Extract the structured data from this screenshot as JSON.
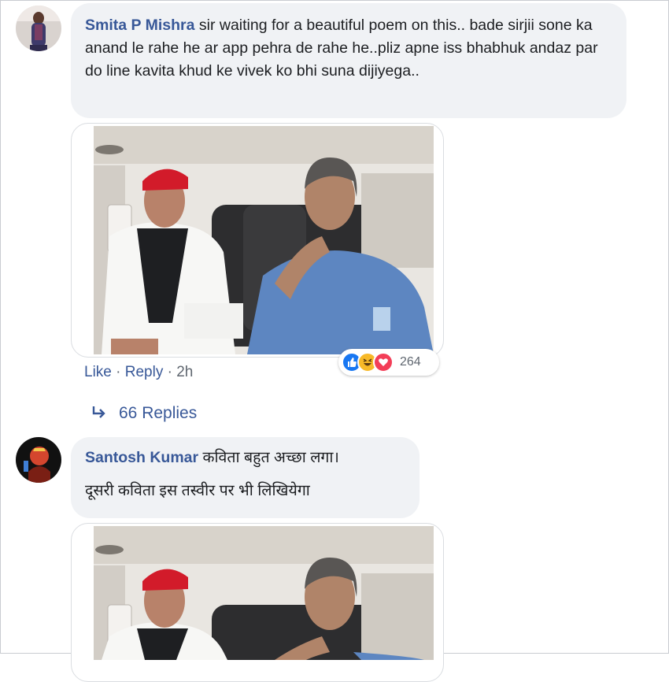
{
  "comments": [
    {
      "author": "Smita P Mishra",
      "text": " sir waiting for a beautiful poem on this.. bade sirjii sone ka anand le rahe he ar app pehra de rahe he..pliz apne iss bhabhuk andaz par do line kavita khud ke vivek ko bhi suna dijiyega..",
      "actions": {
        "like": "Like",
        "dot1": "·",
        "reply": "Reply",
        "dot2": "·",
        "time": "2h"
      },
      "reactions": {
        "icons": [
          "like-icon",
          "haha-icon",
          "love-icon"
        ],
        "count": "264",
        "colors": [
          "#1877f2",
          "#f7b928",
          "#f33e58"
        ]
      },
      "replies": "66 Replies"
    },
    {
      "author": "Santosh Kumar",
      "text_line1": " कविता बहुत अच्छा लगा।",
      "text_line2": "दूसरी कविता इस तस्वीर पर भी लिखियेगा"
    }
  ],
  "colors": {
    "author": "#385898",
    "bubble": "#f0f2f5",
    "link": "#385898",
    "muted": "#606770"
  }
}
